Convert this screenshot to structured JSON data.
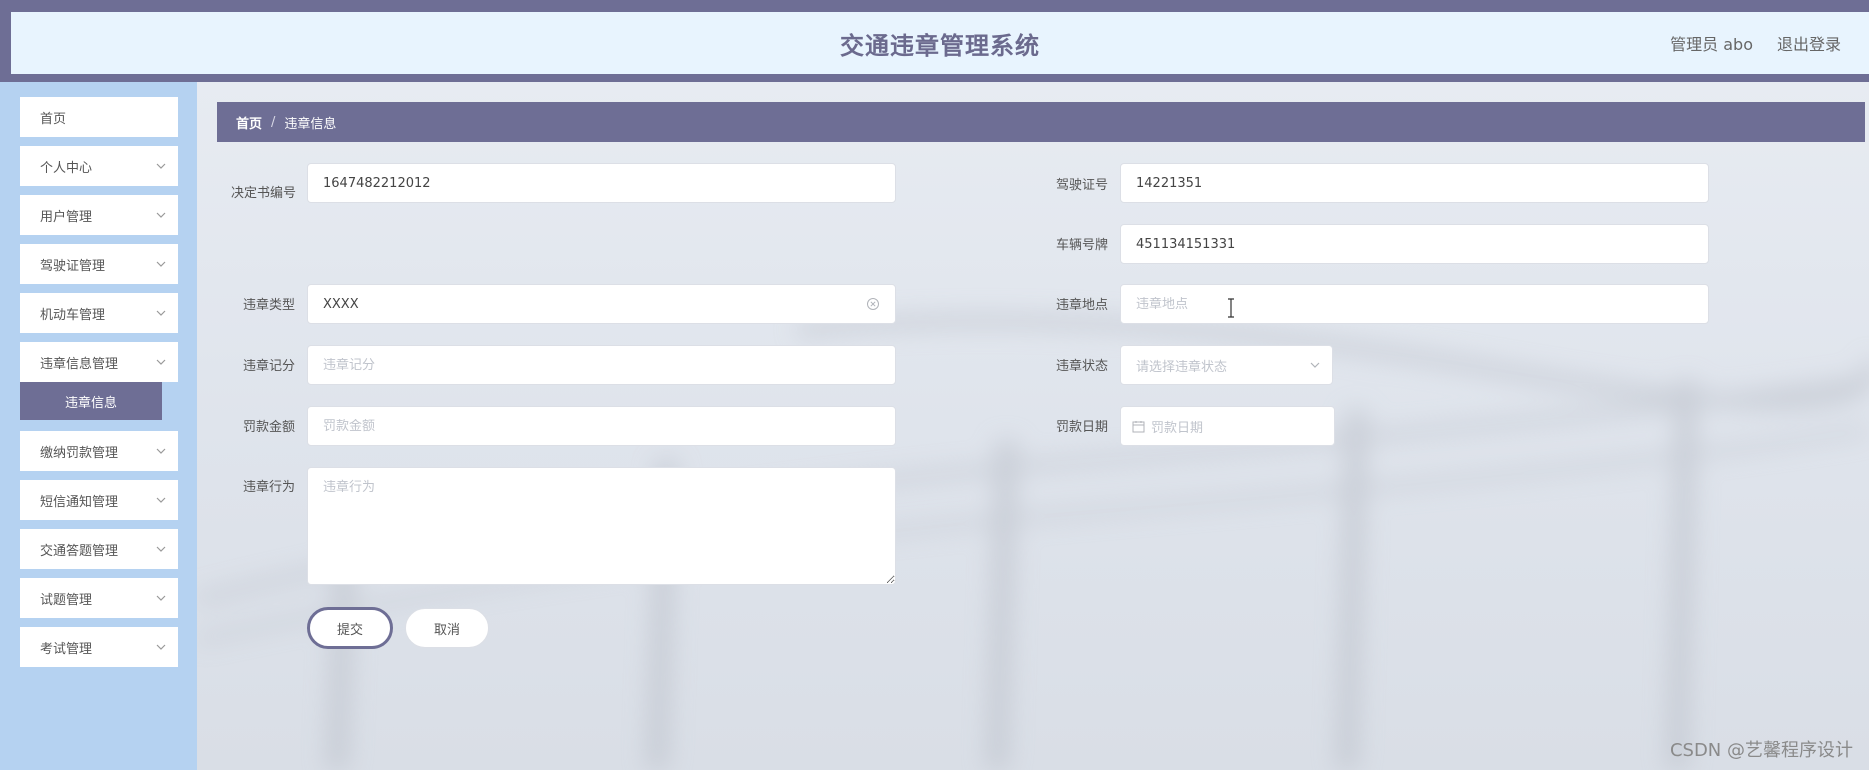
{
  "header": {
    "title": "交通违章管理系统",
    "user": "管理员 abo",
    "logout": "退出登录"
  },
  "sidebar": {
    "items": [
      {
        "label": "首页",
        "expandable": false
      },
      {
        "label": "个人中心",
        "expandable": true
      },
      {
        "label": "用户管理",
        "expandable": true
      },
      {
        "label": "驾驶证管理",
        "expandable": true
      },
      {
        "label": "机动车管理",
        "expandable": true
      },
      {
        "label": "违章信息管理",
        "expandable": true
      },
      {
        "label": "缴纳罚款管理",
        "expandable": true
      },
      {
        "label": "短信通知管理",
        "expandable": true
      },
      {
        "label": "交通答题管理",
        "expandable": true
      },
      {
        "label": "试题管理",
        "expandable": true
      },
      {
        "label": "考试管理",
        "expandable": true
      }
    ],
    "active_sub": "违章信息"
  },
  "breadcrumb": {
    "home": "首页",
    "separator": "/",
    "current": "违章信息"
  },
  "form": {
    "decision_no": {
      "label": "决定书编号",
      "value": "1647482212012"
    },
    "license_no": {
      "label": "驾驶证号",
      "value": "14221351"
    },
    "plate_no": {
      "label": "车辆号牌",
      "value": "451134151331"
    },
    "violation_type": {
      "label": "违章类型",
      "value": "XXXX"
    },
    "violation_place": {
      "label": "违章地点",
      "placeholder": "违章地点"
    },
    "violation_points": {
      "label": "违章记分",
      "placeholder": "违章记分"
    },
    "violation_status": {
      "label": "违章状态",
      "placeholder": "请选择违章状态"
    },
    "fine_amount": {
      "label": "罚款金额",
      "placeholder": "罚款金额"
    },
    "fine_date": {
      "label": "罚款日期",
      "placeholder": "罚款日期"
    },
    "violation_behavior": {
      "label": "违章行为",
      "placeholder": "违章行为"
    },
    "submit": "提交",
    "cancel": "取消"
  },
  "watermark": "CSDN @艺馨程序设计",
  "colors": {
    "accent": "#6e6e95",
    "header_bg": "#e8f4fe",
    "sidebar_bg": "#b5d2f1"
  }
}
